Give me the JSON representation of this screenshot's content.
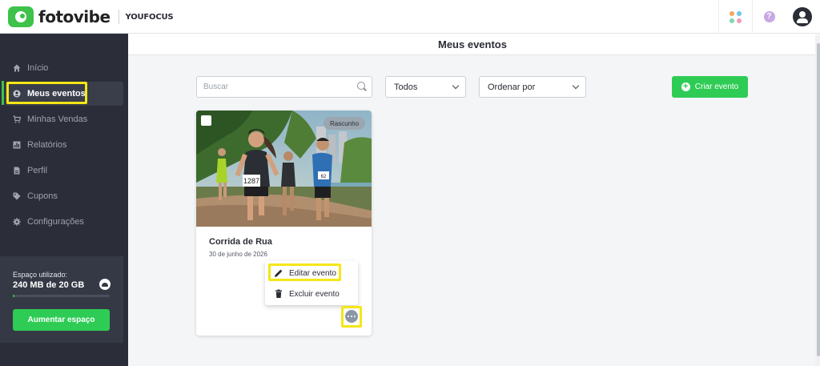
{
  "header": {
    "brand_name": "fotovibe",
    "brand_sub": "YOUFOCUS",
    "brand_color": "#3ec24a",
    "apps_dot_colors": [
      "#f6a65a",
      "#6cc5e9",
      "#7fd6b0",
      "#f49ab8"
    ]
  },
  "sidebar": {
    "items": [
      {
        "label": "Início",
        "icon": "home-icon"
      },
      {
        "label": "Meus eventos",
        "icon": "event-icon"
      },
      {
        "label": "Minhas Vendas",
        "icon": "cart-icon"
      },
      {
        "label": "Relatórios",
        "icon": "report-icon"
      },
      {
        "label": "Perfil",
        "icon": "profile-icon"
      },
      {
        "label": "Cupons",
        "icon": "tag-icon"
      },
      {
        "label": "Configurações",
        "icon": "gear-icon"
      }
    ],
    "active_index": 1,
    "storage": {
      "label": "Espaço utilizado:",
      "value": "240 MB de 20 GB",
      "used_fraction": 0.012,
      "button_label": "Aumentar espaço"
    }
  },
  "main": {
    "title": "Meus eventos",
    "search_placeholder": "Buscar",
    "filter_value": "Todos",
    "sort_value": "Ordenar por",
    "create_label": "Criar evento",
    "accent_color": "#2ecc55",
    "highlight_color": "#f5e617"
  },
  "events": [
    {
      "title": "Corrida de Rua",
      "date": "30 de junho de 2026",
      "badge": "Rascunho",
      "bib_numbers": [
        "1287",
        "62"
      ]
    }
  ],
  "context_menu": {
    "items": [
      {
        "label": "Editar evento",
        "icon": "pencil-icon"
      },
      {
        "label": "Excluir evento",
        "icon": "trash-icon"
      }
    ]
  }
}
